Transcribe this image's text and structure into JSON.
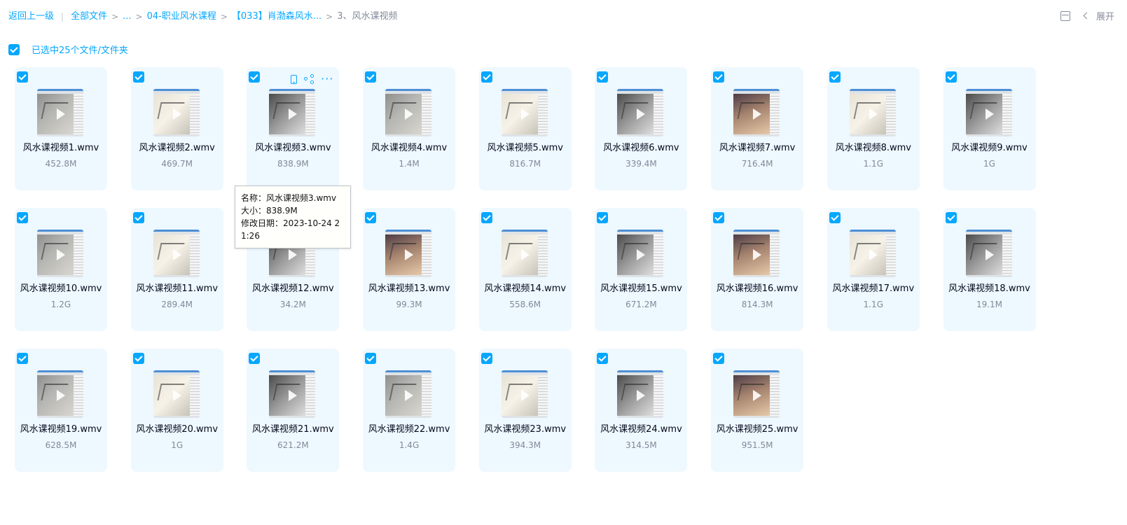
{
  "breadcrumb": {
    "back": "返回上一级",
    "root": "全部文件",
    "ellipsis": "...",
    "level1": "04-职业风水课程",
    "level2": "【033】肖渤森风水...",
    "current": "3、风水课视频"
  },
  "toolbar": {
    "expand_label": "展开",
    "list_icon": "list-view-icon"
  },
  "selection": {
    "label": "已选中25个文件/文件夹"
  },
  "files": [
    {
      "name": "风水课视频1.wmv",
      "size": "452.8M"
    },
    {
      "name": "风水课视频2.wmv",
      "size": "469.7M"
    },
    {
      "name": "风水课视频3.wmv",
      "size": "838.9M"
    },
    {
      "name": "风水课视频4.wmv",
      "size": "1.4M"
    },
    {
      "name": "风水课视频5.wmv",
      "size": "816.7M"
    },
    {
      "name": "风水课视频6.wmv",
      "size": "339.4M"
    },
    {
      "name": "风水课视频7.wmv",
      "size": "716.4M"
    },
    {
      "name": "风水课视频8.wmv",
      "size": "1.1G"
    },
    {
      "name": "风水课视频9.wmv",
      "size": "1G"
    },
    {
      "name": "风水课视频10.wmv",
      "size": "1.2G"
    },
    {
      "name": "风水课视频11.wmv",
      "size": "289.4M"
    },
    {
      "name": "风水课视频12.wmv",
      "size": "34.2M"
    },
    {
      "name": "风水课视频13.wmv",
      "size": "99.3M"
    },
    {
      "name": "风水课视频14.wmv",
      "size": "558.6M"
    },
    {
      "name": "风水课视频15.wmv",
      "size": "671.2M"
    },
    {
      "name": "风水课视频16.wmv",
      "size": "814.3M"
    },
    {
      "name": "风水课视频17.wmv",
      "size": "1.1G"
    },
    {
      "name": "风水课视频18.wmv",
      "size": "19.1M"
    },
    {
      "name": "风水课视频19.wmv",
      "size": "628.5M"
    },
    {
      "name": "风水课视频20.wmv",
      "size": "1G"
    },
    {
      "name": "风水课视频21.wmv",
      "size": "621.2M"
    },
    {
      "name": "风水课视频22.wmv",
      "size": "1.4G"
    },
    {
      "name": "风水课视频23.wmv",
      "size": "394.3M"
    },
    {
      "name": "风水课视频24.wmv",
      "size": "314.5M"
    },
    {
      "name": "风水课视频25.wmv",
      "size": "951.5M"
    }
  ],
  "tooltip": {
    "name_line": "名称：风水课视频3.wmv",
    "size_line": "大小：838.9M",
    "date_line": "修改日期：2023-10-24 21:26"
  },
  "colors": {
    "accent": "#06a7ff",
    "card_bg": "#eef8ff",
    "muted_text": "#818999"
  }
}
